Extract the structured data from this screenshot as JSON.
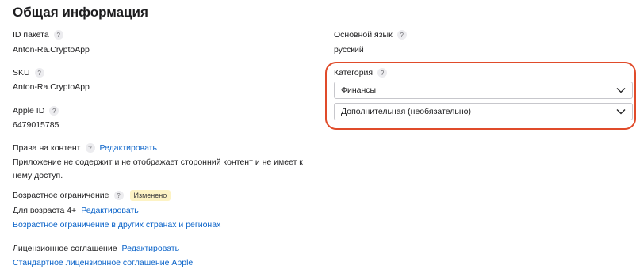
{
  "section_title": "Общая информация",
  "help_symbol": "?",
  "package_id": {
    "label": "ID пакета",
    "value": "Anton-Ra.CryptoApp"
  },
  "sku": {
    "label": "SKU",
    "value": "Anton-Ra.CryptoApp"
  },
  "apple_id": {
    "label": "Apple ID",
    "value": "6479015785"
  },
  "content_rights": {
    "label": "Права на контент",
    "edit_link": "Редактировать",
    "description": "Приложение не содержит и не отображает сторонний контент и не имеет к нему доступ."
  },
  "age_rating": {
    "label": "Возрастное ограничение",
    "badge": "Изменено",
    "value": "Для возраста 4+",
    "edit_link": "Редактировать",
    "other_regions_link": "Возрастное ограничение в других странах и регионах"
  },
  "license": {
    "label": "Лицензионное соглашение",
    "edit_link": "Редактировать",
    "standard_link": "Стандартное лицензионное соглашение Apple"
  },
  "primary_language": {
    "label": "Основной язык",
    "value": "русский"
  },
  "category": {
    "label": "Категория",
    "primary_selected": "Финансы",
    "secondary_selected": "Дополнительная (необязательно)"
  },
  "colors": {
    "link": "#0a63c9",
    "badge_bg": "#fdf3c4",
    "annotation": "#e04b2a"
  }
}
